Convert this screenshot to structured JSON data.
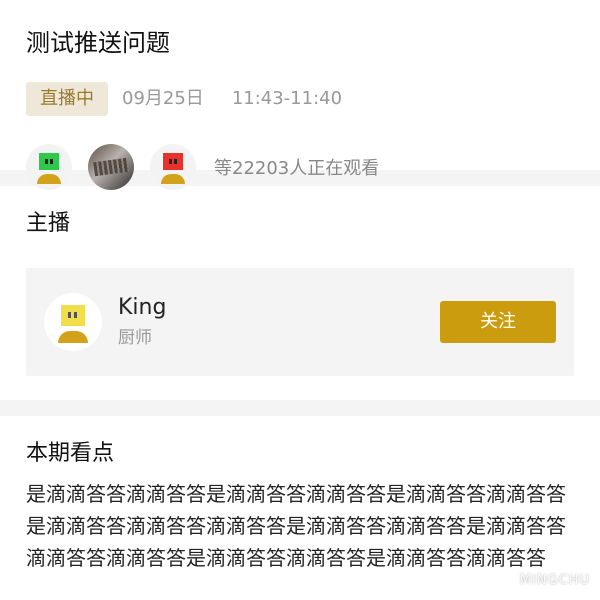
{
  "event": {
    "title": "测试推送问题",
    "status_badge": "直播中",
    "date": "09月25日",
    "time_range": "11:43-11:40",
    "viewer_text": "等22203人正在观看"
  },
  "viewers": [
    {
      "icon": "green-robot-avatar",
      "color": "#2ec94a"
    },
    {
      "icon": "photo-avatar"
    },
    {
      "icon": "red-robot-avatar",
      "color": "#e8312c"
    }
  ],
  "host_section": {
    "title": "主播",
    "name": "King",
    "role": "厨师",
    "follow_label": "关注",
    "avatar_color": "#f2de4b",
    "accent": "#cc9c0f"
  },
  "highlights": {
    "title": "本期看点",
    "body": "是滴滴答答滴滴答答是滴滴答答滴滴答答是滴滴答答滴滴答答是滴滴答答滴滴答答滴滴答答是滴滴答答滴滴答答是滴滴答答滴滴答答滴滴答答是滴滴答答滴滴答答是滴滴答答滴滴答答"
  },
  "watermark": "MINGCHU"
}
